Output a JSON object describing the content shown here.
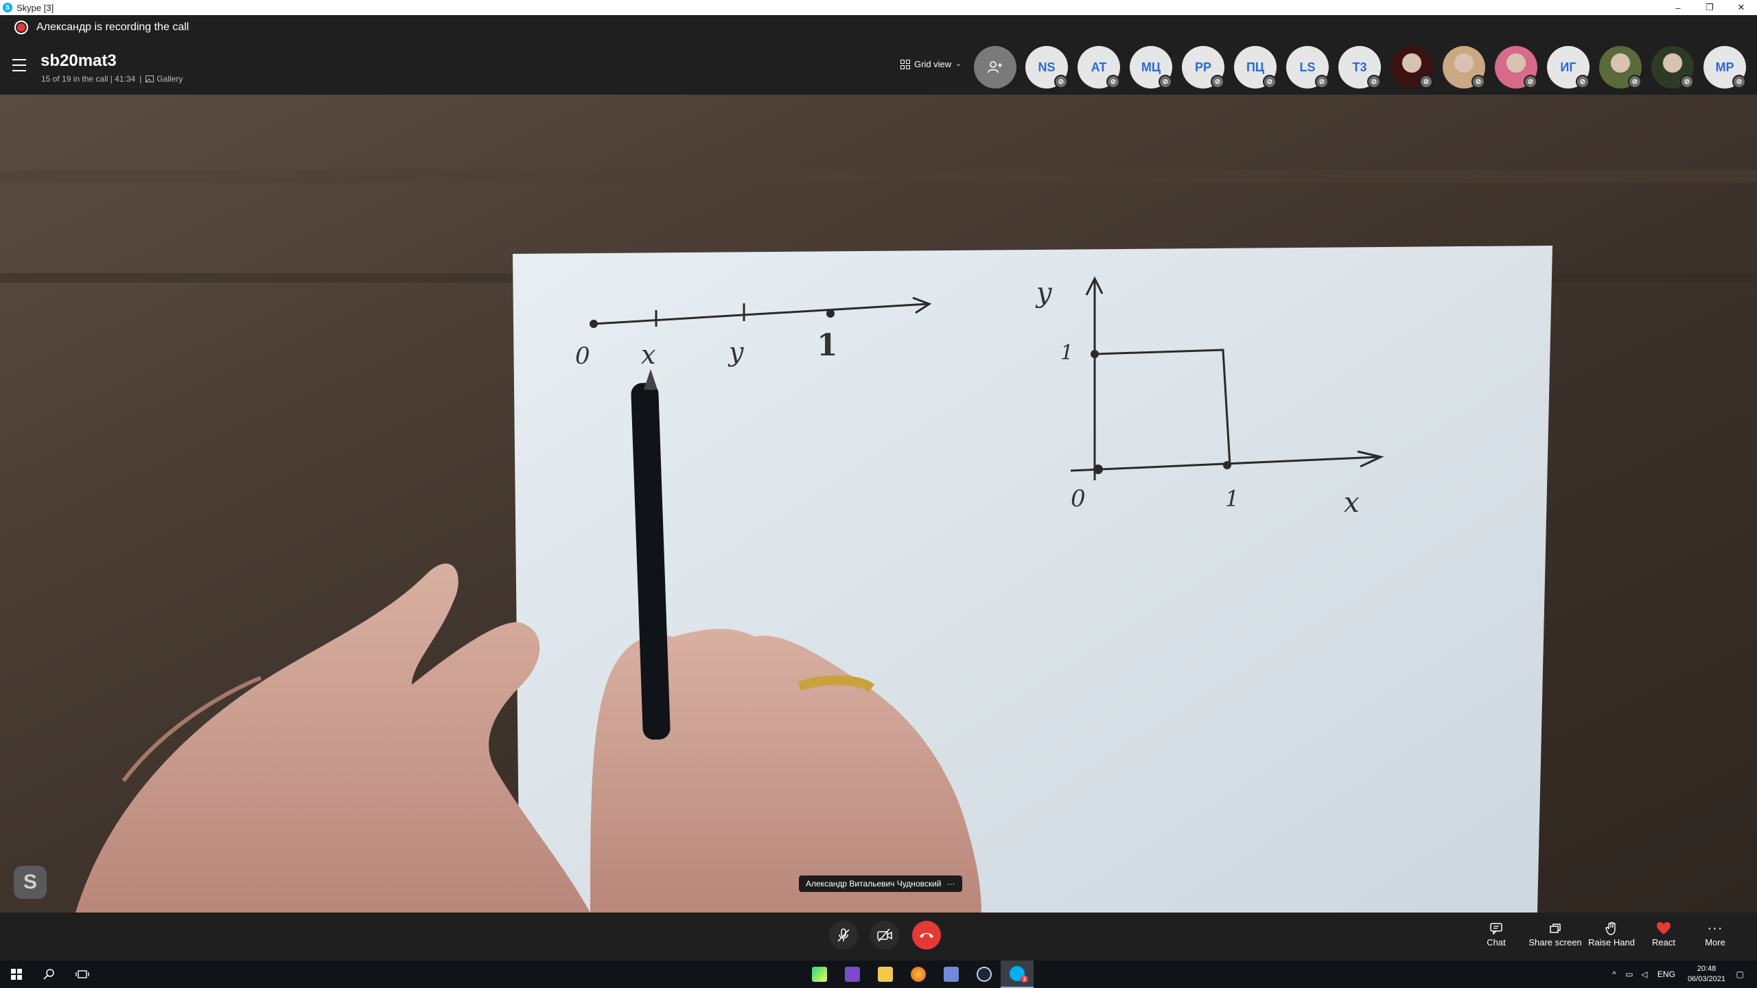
{
  "window": {
    "title": "Skype [3]",
    "controls": {
      "minimize": "–",
      "restore": "❐",
      "close": "✕"
    }
  },
  "recording": {
    "text": "Александр is recording the call"
  },
  "call": {
    "title": "sb20mat3",
    "status": "15 of 19 in the call | 41:34",
    "separator": "|",
    "gallery_label": "Gallery",
    "view_label": "Grid view",
    "participants": [
      {
        "initials": "NS",
        "type": "initials"
      },
      {
        "initials": "AT",
        "type": "initials"
      },
      {
        "initials": "МЦ",
        "type": "initials"
      },
      {
        "initials": "PP",
        "type": "initials"
      },
      {
        "initials": "ПЦ",
        "type": "initials"
      },
      {
        "initials": "LS",
        "type": "initials"
      },
      {
        "initials": "T3",
        "type": "initials"
      },
      {
        "initials": "",
        "type": "photo",
        "color": "#3a1212"
      },
      {
        "initials": "",
        "type": "photo",
        "color": "#c9a882"
      },
      {
        "initials": "",
        "type": "photo",
        "color": "#d86a8a"
      },
      {
        "initials": "ИГ",
        "type": "initials"
      },
      {
        "initials": "",
        "type": "photo",
        "color": "#5a6a3a"
      },
      {
        "initials": "",
        "type": "photo",
        "color": "#2f3a24"
      },
      {
        "initials": "MP",
        "type": "initials"
      }
    ]
  },
  "video": {
    "speaker": "Александр Витальевич Чудновский",
    "speaker_more": "···",
    "badge": "S",
    "sketch_labels": {
      "line_zero": "0",
      "line_x": "x",
      "line_y": "y",
      "line_one": "1",
      "axis_y": "y",
      "axis_one_y": "1",
      "axis_zero": "0",
      "axis_one_x": "1",
      "axis_x": "x"
    }
  },
  "controls": {
    "chat": "Chat",
    "share": "Share screen",
    "raise": "Raise Hand",
    "react": "React",
    "more": "More"
  },
  "taskbar": {
    "lang": "ENG",
    "time": "20:48",
    "date": "06/03/2021",
    "skype_badge": "3"
  },
  "colors": {
    "accent": "#2a6ad4",
    "end_call": "#e53935",
    "react_heart": "#e53935"
  }
}
